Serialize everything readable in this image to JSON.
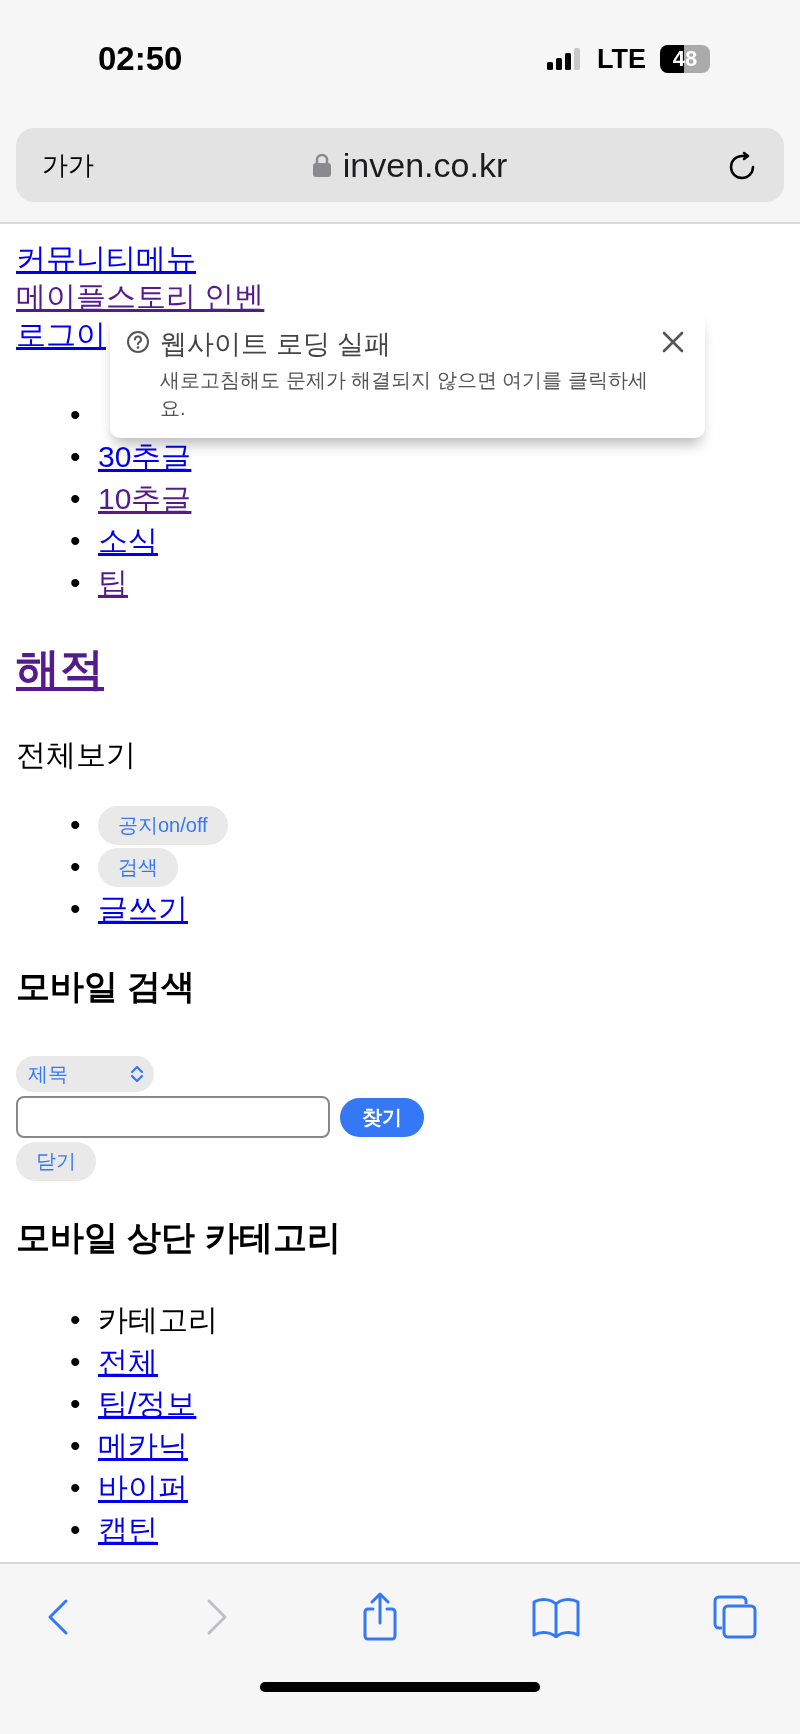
{
  "status_bar": {
    "time": "02:50",
    "network": "LTE",
    "battery": "48"
  },
  "address_bar": {
    "text_size_button": "가가",
    "url": "inven.co.kr"
  },
  "top_links": [
    {
      "label": "커뮤니티메뉴",
      "visited": false
    },
    {
      "label": "메이플스토리 인벤",
      "visited": true
    },
    {
      "label": "로그이",
      "visited": false
    }
  ],
  "top_list": [
    {
      "bullet": "•"
    },
    {
      "bullet": "•",
      "label": "30추글",
      "visited": false
    },
    {
      "bullet": "•",
      "label": "10추글",
      "visited": true
    },
    {
      "bullet": "•",
      "label": "소식",
      "visited": false
    },
    {
      "bullet": "•",
      "label": "팁",
      "visited": true
    }
  ],
  "board_title": {
    "label": "해적",
    "visited": true
  },
  "view_all": "전체보기",
  "board_actions": [
    {
      "bullet": "•",
      "kind": "button",
      "label": "공지on/off"
    },
    {
      "bullet": "•",
      "kind": "button",
      "label": "검색"
    },
    {
      "bullet": "•",
      "kind": "link",
      "label": "글쓰기",
      "visited": false
    }
  ],
  "mobile_search": {
    "heading": "모바일 검색",
    "select_value": "제목",
    "submit": "찾기",
    "close": "닫기"
  },
  "category_section": {
    "heading": "모바일 상단 카테고리",
    "items": [
      {
        "bullet": "•",
        "kind": "text",
        "label": "카테고리"
      },
      {
        "bullet": "•",
        "kind": "link",
        "label": "전체",
        "visited": false
      },
      {
        "bullet": "•",
        "kind": "link",
        "label": "팁/정보",
        "visited": false
      },
      {
        "bullet": "•",
        "kind": "link",
        "label": "메카닉",
        "visited": false
      },
      {
        "bullet": "•",
        "kind": "link",
        "label": "바이퍼",
        "visited": false
      },
      {
        "bullet": "•",
        "kind": "link",
        "label": "캡틴",
        "visited": false
      }
    ]
  },
  "error_popup": {
    "title": "웹사이트 로딩 실패",
    "message": "새로고침해도 문제가 해결되지 않으면 여기를 클릭하세요."
  },
  "toolbar": {
    "back_enabled": true,
    "forward_enabled": false
  }
}
